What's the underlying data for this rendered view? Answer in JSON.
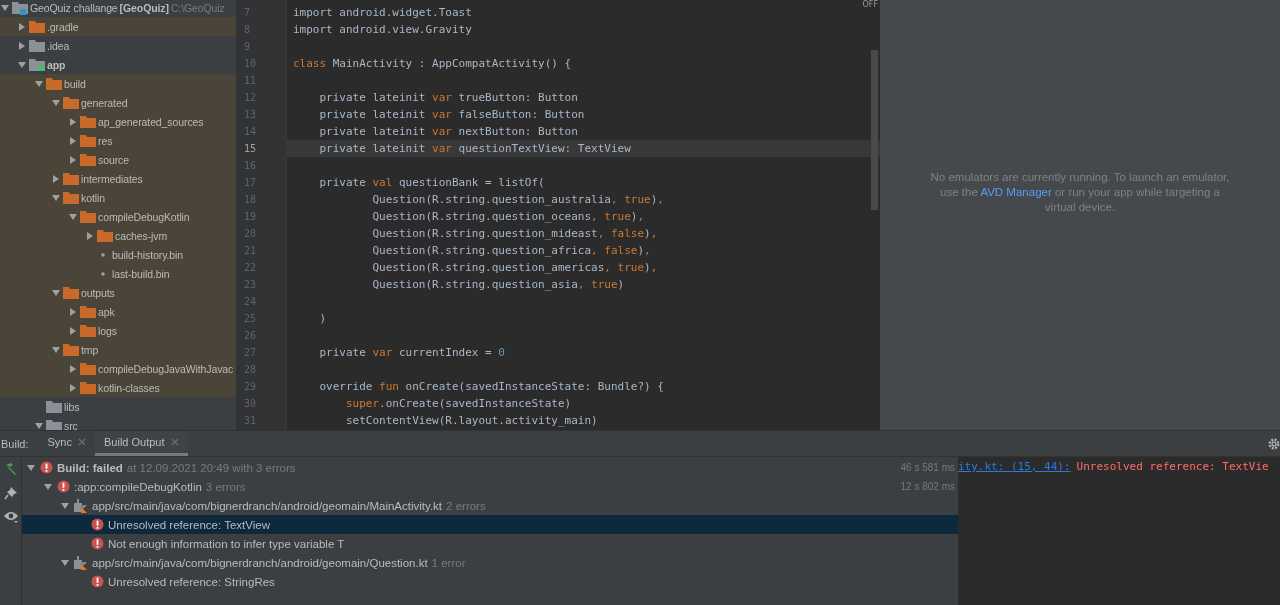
{
  "project_tree": {
    "root": {
      "name": "GeoQuiz challange",
      "module": "[GeoQuiz]",
      "path": "C:\\GeoQuiz",
      "expanded": true,
      "children": [
        {
          "name": ".gradle",
          "kind": "folder",
          "excluded": true,
          "expanded": false
        },
        {
          "name": ".idea",
          "kind": "folder",
          "excluded": false,
          "expanded": false
        },
        {
          "name": "app",
          "kind": "module",
          "excluded": false,
          "expanded": true,
          "children": [
            {
              "name": "build",
              "kind": "folder",
              "excluded": true,
              "expanded": true,
              "children": [
                {
                  "name": "generated",
                  "kind": "folder",
                  "excluded": true,
                  "expanded": true,
                  "children": [
                    {
                      "name": "ap_generated_sources",
                      "kind": "folder",
                      "excluded": true,
                      "expanded": false
                    },
                    {
                      "name": "res",
                      "kind": "folder",
                      "excluded": true,
                      "expanded": false
                    },
                    {
                      "name": "source",
                      "kind": "folder",
                      "excluded": true,
                      "expanded": false
                    }
                  ]
                },
                {
                  "name": "intermediates",
                  "kind": "folder",
                  "excluded": true,
                  "expanded": false
                },
                {
                  "name": "kotlin",
                  "kind": "folder",
                  "excluded": true,
                  "expanded": true,
                  "children": [
                    {
                      "name": "compileDebugKotlin",
                      "kind": "folder",
                      "excluded": true,
                      "expanded": true,
                      "children": [
                        {
                          "name": "caches-jvm",
                          "kind": "folder",
                          "excluded": true,
                          "expanded": false
                        },
                        {
                          "name": "build-history.bin",
                          "kind": "file",
                          "excluded": true
                        },
                        {
                          "name": "last-build.bin",
                          "kind": "file",
                          "excluded": true
                        }
                      ]
                    }
                  ]
                },
                {
                  "name": "outputs",
                  "kind": "folder",
                  "excluded": true,
                  "expanded": true,
                  "children": [
                    {
                      "name": "apk",
                      "kind": "folder",
                      "excluded": true,
                      "expanded": false
                    },
                    {
                      "name": "logs",
                      "kind": "folder",
                      "excluded": true,
                      "expanded": false
                    }
                  ]
                },
                {
                  "name": "tmp",
                  "kind": "folder",
                  "excluded": true,
                  "expanded": true,
                  "children": [
                    {
                      "name": "compileDebugJavaWithJavac",
                      "kind": "folder",
                      "excluded": true,
                      "expanded": false
                    },
                    {
                      "name": "kotlin-classes",
                      "kind": "folder",
                      "excluded": true,
                      "expanded": false
                    }
                  ]
                }
              ]
            },
            {
              "name": "libs",
              "kind": "leaf-folder",
              "excluded": false
            },
            {
              "name": "src",
              "kind": "folder",
              "excluded": false,
              "expanded": true
            }
          ]
        }
      ]
    }
  },
  "editor": {
    "mode_badge": "OFF",
    "lines": [
      {
        "number": "7",
        "current": false,
        "tokens": [
          {
            "kind": "plain",
            "text": "import android.widget.Toast"
          }
        ]
      },
      {
        "number": "8",
        "current": false,
        "tokens": [
          {
            "kind": "plain",
            "text": "import android.view.Gravity"
          }
        ]
      },
      {
        "number": "9",
        "current": false
      },
      {
        "number": "10",
        "current": false,
        "tokens": [
          {
            "kind": "keyword",
            "text": "class"
          },
          {
            "kind": "plain",
            "text": " MainActivity : AppCompatActivity() {"
          }
        ]
      },
      {
        "number": "11",
        "current": false
      },
      {
        "number": "12",
        "current": false,
        "tokens": [
          {
            "kind": "plain",
            "text": "    private lateinit "
          },
          {
            "kind": "keyword",
            "text": "var"
          },
          {
            "kind": "plain",
            "text": " trueButton: Button"
          }
        ]
      },
      {
        "number": "13",
        "current": false,
        "tokens": [
          {
            "kind": "plain",
            "text": "    private lateinit "
          },
          {
            "kind": "keyword",
            "text": "var"
          },
          {
            "kind": "plain",
            "text": " falseButton: Button"
          }
        ]
      },
      {
        "number": "14",
        "current": false,
        "tokens": [
          {
            "kind": "plain",
            "text": "    private lateinit "
          },
          {
            "kind": "keyword",
            "text": "var"
          },
          {
            "kind": "plain",
            "text": " nextButton: Button"
          }
        ]
      },
      {
        "number": "15",
        "current": true,
        "tokens": [
          {
            "kind": "plain",
            "text": "    private lateinit "
          },
          {
            "kind": "keyword",
            "text": "var"
          },
          {
            "kind": "plain",
            "text": " questionTextView: TextView"
          }
        ]
      },
      {
        "number": "16",
        "current": false
      },
      {
        "number": "17",
        "current": false,
        "tokens": [
          {
            "kind": "plain",
            "text": "    private "
          },
          {
            "kind": "keyword",
            "text": "val"
          },
          {
            "kind": "plain",
            "text": " questionBank = listOf("
          }
        ]
      },
      {
        "number": "18",
        "current": false,
        "tokens": [
          {
            "kind": "plain",
            "text": "            Question(R.string.question_australia"
          },
          {
            "kind": "keyword",
            "text": ", true"
          },
          {
            "kind": "plain",
            "text": ")"
          },
          {
            "kind": "keyword",
            "text": ","
          }
        ]
      },
      {
        "number": "19",
        "current": false,
        "tokens": [
          {
            "kind": "plain",
            "text": "            Question(R.string.question_oceans"
          },
          {
            "kind": "keyword",
            "text": ", true"
          },
          {
            "kind": "plain",
            "text": ")"
          },
          {
            "kind": "keyword",
            "text": ","
          }
        ]
      },
      {
        "number": "20",
        "current": false,
        "tokens": [
          {
            "kind": "plain",
            "text": "            Question(R.string.question_mideast"
          },
          {
            "kind": "keyword",
            "text": ", false"
          },
          {
            "kind": "plain",
            "text": ")"
          },
          {
            "kind": "keyword",
            "text": ","
          }
        ]
      },
      {
        "number": "21",
        "current": false,
        "tokens": [
          {
            "kind": "plain",
            "text": "            Question(R.string.question_africa"
          },
          {
            "kind": "keyword",
            "text": ", false"
          },
          {
            "kind": "plain",
            "text": ")"
          },
          {
            "kind": "keyword",
            "text": ","
          }
        ]
      },
      {
        "number": "22",
        "current": false,
        "tokens": [
          {
            "kind": "plain",
            "text": "            Question(R.string.question_americas"
          },
          {
            "kind": "keyword",
            "text": ", true"
          },
          {
            "kind": "plain",
            "text": ")"
          },
          {
            "kind": "keyword",
            "text": ","
          }
        ]
      },
      {
        "number": "23",
        "current": false,
        "tokens": [
          {
            "kind": "plain",
            "text": "            Question(R.string.question_asia"
          },
          {
            "kind": "keyword",
            "text": ", true"
          },
          {
            "kind": "plain",
            "text": ")"
          }
        ]
      },
      {
        "number": "24",
        "current": false
      },
      {
        "number": "25",
        "current": false,
        "tokens": [
          {
            "kind": "plain",
            "text": "    )"
          }
        ]
      },
      {
        "number": "26",
        "current": false
      },
      {
        "number": "27",
        "current": false,
        "tokens": [
          {
            "kind": "plain",
            "text": "    private "
          },
          {
            "kind": "keyword",
            "text": "var"
          },
          {
            "kind": "plain",
            "text": " currentIndex = "
          },
          {
            "kind": "number",
            "text": "0"
          }
        ]
      },
      {
        "number": "28",
        "current": false
      },
      {
        "number": "29",
        "current": false,
        "tokens": [
          {
            "kind": "plain",
            "text": "    override "
          },
          {
            "kind": "keyword",
            "text": "fun"
          },
          {
            "kind": "plain",
            "text": " onCreate(savedInstanceState: Bundle?) {"
          }
        ]
      },
      {
        "number": "30",
        "current": false,
        "tokens": [
          {
            "kind": "keyword",
            "text": "        super"
          },
          {
            "kind": "plain",
            "text": ".onCreate(savedInstanceState)"
          }
        ]
      },
      {
        "number": "31",
        "current": false,
        "tokens": [
          {
            "kind": "plain",
            "text": "        setContentView(R.layout.activity_main)"
          }
        ]
      }
    ]
  },
  "emulator": {
    "message_before": "No emulators are currently running. To launch an emulator, use the",
    "link": "AVD Manager",
    "message_after": "or run your app while targeting a virtual device."
  },
  "build_window": {
    "title": "Build:",
    "tabs": [
      {
        "label": "Sync",
        "selected": false
      },
      {
        "label": "Build Output",
        "selected": true
      }
    ],
    "tree": [
      {
        "kind": "build",
        "title": "Build: failed",
        "detail": "at 12.09.2021 20:49 with 3 errors",
        "time": "46 s 581 ms",
        "selected": false,
        "expanded": true,
        "children": [
          {
            "kind": "task",
            "title": ":app:compileDebugKotlin",
            "detail": "3 errors",
            "time": "12 s 802 ms",
            "selected": false,
            "expanded": true,
            "children": [
              {
                "kind": "kotlin-file",
                "title": "app/src/main/java/com/bignerdranch/android/geomain/MainActivity.kt",
                "detail": "2 errors",
                "selected": false,
                "expanded": true,
                "children": [
                  {
                    "kind": "error",
                    "title": "Unresolved reference: TextView",
                    "selected": true
                  },
                  {
                    "kind": "error",
                    "title": "Not enough information to infer type variable T",
                    "selected": false
                  }
                ]
              },
              {
                "kind": "kotlin-file",
                "title": "app/src/main/java/com/bignerdranch/android/geomain/Question.kt",
                "detail": "1 error",
                "selected": false,
                "expanded": true,
                "children": [
                  {
                    "kind": "error",
                    "title": "Unresolved reference: StringRes",
                    "selected": false
                  }
                ]
              }
            ]
          }
        ]
      }
    ],
    "console": {
      "link": "ity.kt: (15, 44):",
      "message": "Unresolved reference: TextVie"
    }
  }
}
